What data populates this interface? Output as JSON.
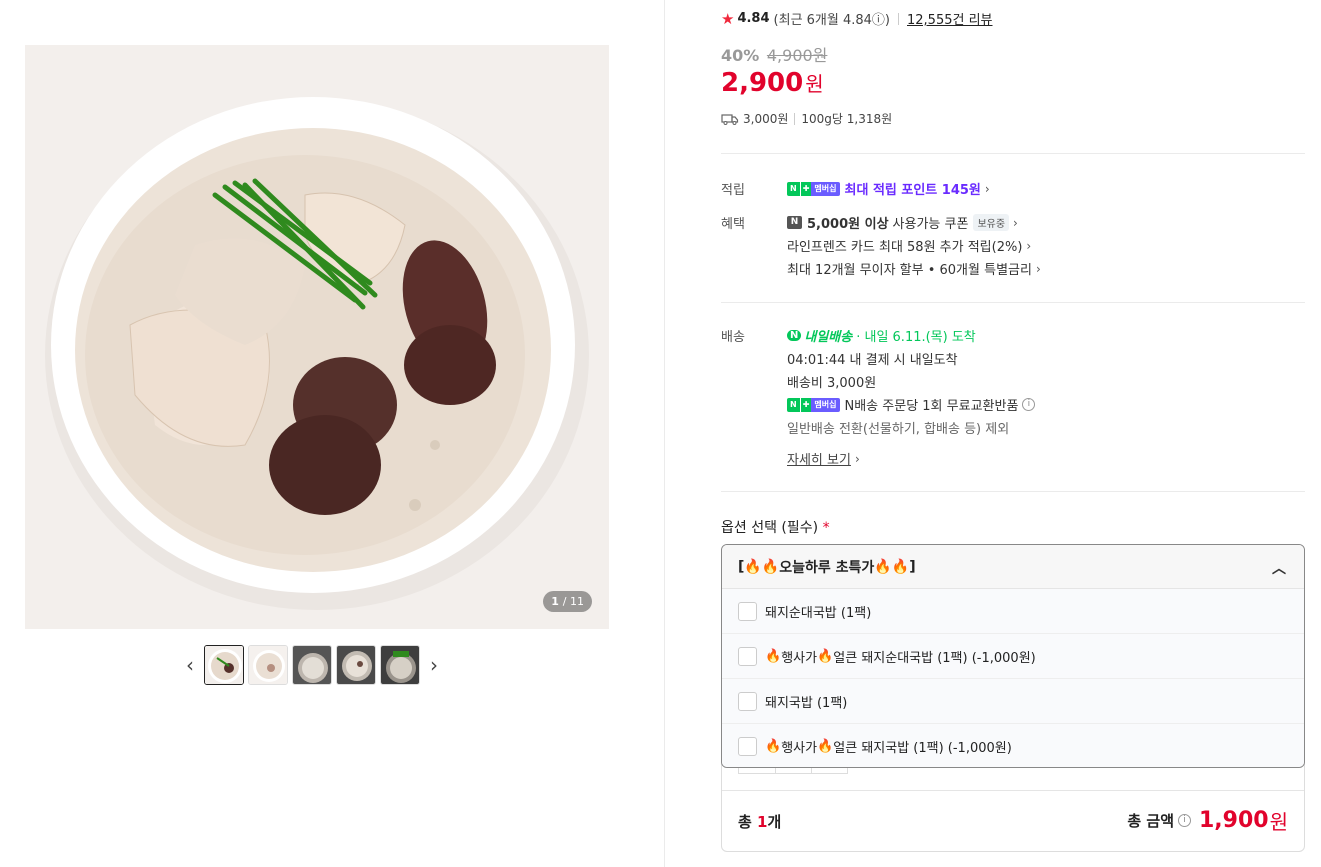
{
  "gallery": {
    "counter_current": "1",
    "counter_total": "/ 11",
    "prev_icon": "chevron-left-icon",
    "next_icon": "chevron-right-icon",
    "thumbnail_count": 5
  },
  "rating": {
    "score": "4.84",
    "recent": "(최근 6개월 4.84ⓘ)",
    "reviews": "12,555건 리뷰"
  },
  "price": {
    "discount": "40%",
    "original": "4,900원",
    "sale_number": "2,900",
    "sale_unit": "원",
    "shipping": "3,000원",
    "unit_price": "100g당 1,318원"
  },
  "points": {
    "label": "적립",
    "badge_n": "N",
    "badge_plus": "✚",
    "badge_membership": "멤버십",
    "text": "최대 적립 포인트 145원"
  },
  "benefits": {
    "label": "혜택",
    "coupon_badge": "N",
    "coupon_bold": "5,000원 이상",
    "coupon_text": "사용가능 쿠폰",
    "coupon_chip": "보유중",
    "card": "라인프렌즈 카드 최대 58원 추가 적립(2%)",
    "installment": "최대 12개월 무이자 할부 • 60개월 특별금리"
  },
  "delivery": {
    "label": "배송",
    "logo_text": "내일배송",
    "arrival": "· 내일 6.11.(목) 도착",
    "deadline": "04:01:44  내 결제 시 내일도착",
    "fee": "배송비 3,000원",
    "exchange": "N배송 주문당 1회 무료교환반품",
    "exception": "일반배송 전환(선물하기, 합배송 등) 제외",
    "more": "자세히 보기"
  },
  "options": {
    "title": "옵션 선택 (필수)",
    "required_mark": "*",
    "header_prefix": "[",
    "header_text": "오늘하루 초특가",
    "header_suffix": "]",
    "items": [
      {
        "fire": false,
        "text": "돼지순대국밥 (1팩)"
      },
      {
        "fire": true,
        "pre": "행사가",
        "text": "얼큰 돼지순대국밥 (1팩) (-1,000원)"
      },
      {
        "fire": false,
        "text": "돼지국밥 (1팩)"
      },
      {
        "fire": true,
        "pre": "행사가",
        "text": "얼큰 돼지국밥 (1팩) (-1,000원)"
      }
    ]
  },
  "total": {
    "count_prefix": "총 ",
    "count": "1",
    "count_suffix": "개",
    "amount_label": "총 금액",
    "amount": "1,900",
    "amount_unit": "원"
  },
  "colors": {
    "accent_red": "#e1032c",
    "naver_green": "#03c75a",
    "membership_purple": "#6a2bff"
  }
}
